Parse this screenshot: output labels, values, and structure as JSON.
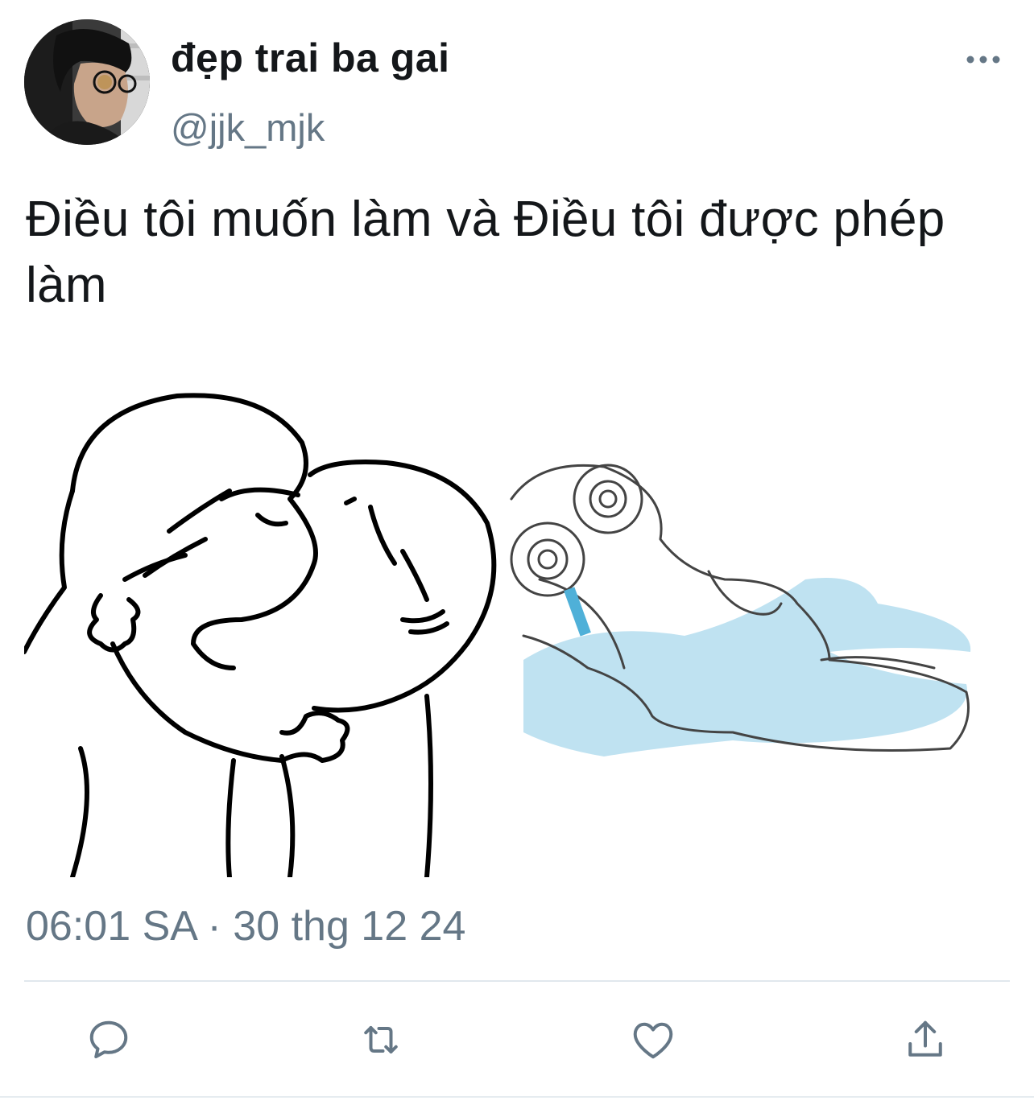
{
  "tweet": {
    "display_name": "đẹp trai ba gai",
    "handle": "@jjk_mjk",
    "text": "Điều tôi muốn làm và Điều tôi được phép làm",
    "timestamp": "06:01 SA · 30 thg 12 24",
    "media_description": "meme"
  },
  "actions": [
    {
      "name": "reply",
      "icon": "comment-icon"
    },
    {
      "name": "retweet",
      "icon": "retweet-icon"
    },
    {
      "name": "like",
      "icon": "heart-icon"
    },
    {
      "name": "share",
      "icon": "share-icon"
    }
  ],
  "colors": {
    "text_primary": "#14171a",
    "text_secondary": "#657786",
    "icon": "#657786",
    "divider": "#e1e8ed",
    "sketch_blue": "#9fd3ea"
  }
}
